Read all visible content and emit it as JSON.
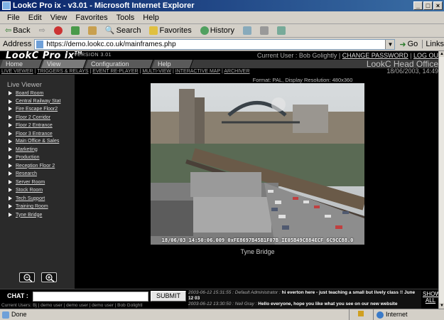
{
  "window": {
    "title": "LookC Pro ix - v3.01 - Microsoft Internet Explorer"
  },
  "menu": [
    "File",
    "Edit",
    "View",
    "Favorites",
    "Tools",
    "Help"
  ],
  "toolbar": {
    "back": "Back",
    "search": "Search",
    "favorites": "Favorites",
    "history": "History"
  },
  "address": {
    "label": "Address",
    "url": "https://demo.lookc.co.uk/mainframes.php",
    "go": "Go",
    "links": "Links"
  },
  "app": {
    "logo": "LookC Pro ix",
    "logo_tm": "TM",
    "version": "VERSION 3.01",
    "current_user_prefix": "Current User : Bob Golightly |",
    "change_password": "CHANGE PASSWORD",
    "logout": "LOG OU",
    "office": "LookC Head Office",
    "date": "18/06/2003, 14:49"
  },
  "nav_tabs": [
    "Home",
    "View",
    "Configuration",
    "Help"
  ],
  "subnav": [
    "LIVE VIEWER",
    "TRIGGERS & RELAYS",
    "EVENT RE-PLAYER",
    "MULTI-VIEW",
    "INTERACTIVE MAP",
    "ARCHIVER"
  ],
  "sidebar": {
    "title": "Live Viewer",
    "items": [
      "Board Room",
      "Central Railway Stat",
      "Fire Escape Floor2",
      "Floor 2 Corridor",
      "Floor 2 Entrance",
      "Floor 3 Entrance",
      "Main Office & Sales",
      "Marketing",
      "Production",
      "Reception Floor 2",
      "Research",
      "Server Room",
      "Stock Room",
      "Tech Support",
      "Training Room",
      "Tyne Bridge"
    ]
  },
  "camera": {
    "format_info": "Format: PAL, Display Resolution: 480x360",
    "overlay": "18/06/03 14:50:06.009 0xFE8697B45B1F07B IE05B49C884ECF 6C9CC88.0",
    "name": "Tyne Bridge"
  },
  "chat": {
    "label": "CHAT :",
    "input_value": "",
    "submit": "SUBMIT",
    "users": "Current Users:  Bj  |  demo user  |  demo user  |  demo user  |  Bob Golightl",
    "messages": [
      {
        "ts": "2003-06-12 15:31:55 : Default Administrator :",
        "text": "hi everton here - just teaching a small but lively class !! June 12 03"
      },
      {
        "ts": "2003-06-12 13:30:50 : Neil Gray :",
        "text": "Hello everyone, hope you like what you see on our new website"
      }
    ],
    "show_all": "SHOW ALL"
  },
  "status": {
    "left": "Done",
    "zone": "Internet"
  }
}
